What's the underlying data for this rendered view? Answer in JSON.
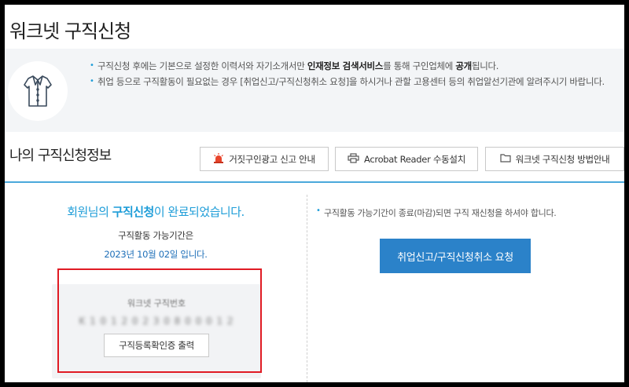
{
  "header": {
    "title": "워크넷 구직신청"
  },
  "notice": {
    "line1": {
      "before": "구직신청 후에는 기본으로 설정한 이력서와 자기소개서만 ",
      "bold1": "인재정보 검색서비스",
      "middle": "를 통해 구인업체에 ",
      "bold2": "공개",
      "after": "됩니다."
    },
    "line2": "취업 등으로 구직활동이 필요없는 경우 [취업신고/구직신청취소 요청]을 하시거나 관할 고용센터 등의 취업알선기관에 알려주시기 바랍니다."
  },
  "section": {
    "title": "나의 구직신청정보",
    "buttons": {
      "fake_ad": "거짓구인광고 신고 안내",
      "acrobat": "Acrobat Reader 수동설치",
      "guide": "워크넷 구직신청 방법안내"
    }
  },
  "status": {
    "msg_prefix": "회원님의 ",
    "msg_highlight": "구직신청",
    "msg_suffix": "이 완료되었습니다.",
    "period_label": "구직활동 가능기간은",
    "period_date": "2023년 10월 02일 입니다."
  },
  "jobseeker": {
    "number_label": "워크넷 구직번호",
    "number_value": "K 1 0 1 2 0 2 3 0 8 0 0 0 1 2",
    "print_label": "구직등록확인증 출력"
  },
  "right_panel": {
    "note": "구직활동 가능기간이 종료(마감)되면 구직 재신청을 하셔야 합니다.",
    "request_label": "취업신고/구직신청취소 요청"
  },
  "colors": {
    "accent": "#1e9dd8",
    "button": "#2b82c9",
    "highlight_frame": "#e01b24"
  }
}
